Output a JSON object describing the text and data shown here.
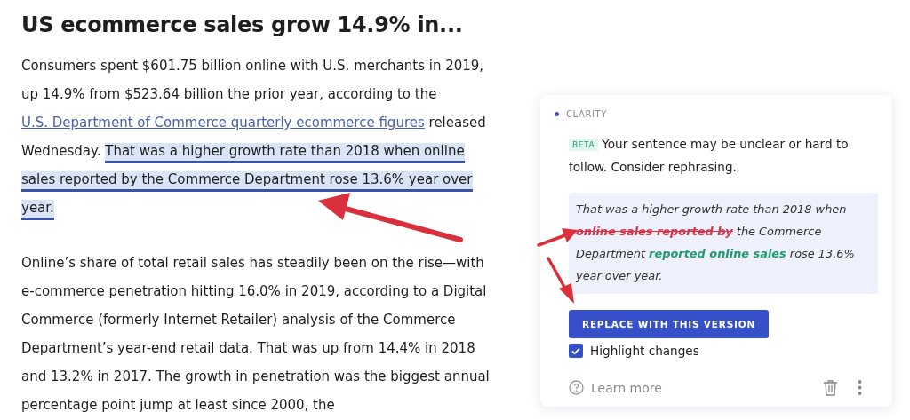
{
  "article": {
    "title": "US ecommerce sales grow 14.9% in...",
    "paragraphs": [
      {
        "segments": [
          {
            "kind": "plain",
            "text": "Consumers spent $601.75 billion online with U.S. merchants in 2019, up 14.9% from $523.64 billion the prior year, according to the "
          },
          {
            "kind": "link",
            "text": "U.S. Department of Commerce quarterly ecommerce figures"
          },
          {
            "kind": "plain",
            "text": " released Wednesday. "
          },
          {
            "kind": "flagged",
            "text": "That was a higher growth rate than 2018 when online sales reported by the Commerce Department rose 13.6% year over year."
          }
        ]
      },
      {
        "segments": [
          {
            "kind": "plain",
            "text": "Online’s share of total retail sales has steadily been on the rise—with e-commerce penetration hitting 16.0% in 2019, according to a Digital Commerce (formerly Internet Retailer) analysis of the Commerce Department’s year-end retail data. That was up from 14.4% in 2018 and 13.2% in 2017. The growth in penetration was the biggest annual percentage point jump at least since 2000, the"
          }
        ]
      }
    ]
  },
  "suggestion_card": {
    "category": "CLARITY",
    "badge": "BETA",
    "message": "Your sentence may be unclear or hard to follow. Consider rephrasing.",
    "rewrite": [
      {
        "kind": "plain",
        "text": "That was a higher growth rate than 2018 when "
      },
      {
        "kind": "deleted",
        "text": "online sales reported by"
      },
      {
        "kind": "plain",
        "text": " the Commerce Department "
      },
      {
        "kind": "inserted",
        "text": "reported online sales"
      },
      {
        "kind": "plain",
        "text": " rose 13.6% year over year."
      }
    ],
    "replace_button": "REPLACE WITH THIS VERSION",
    "highlight_changes": {
      "label": "Highlight changes",
      "checked": true
    },
    "learn_more": "Learn more"
  }
}
